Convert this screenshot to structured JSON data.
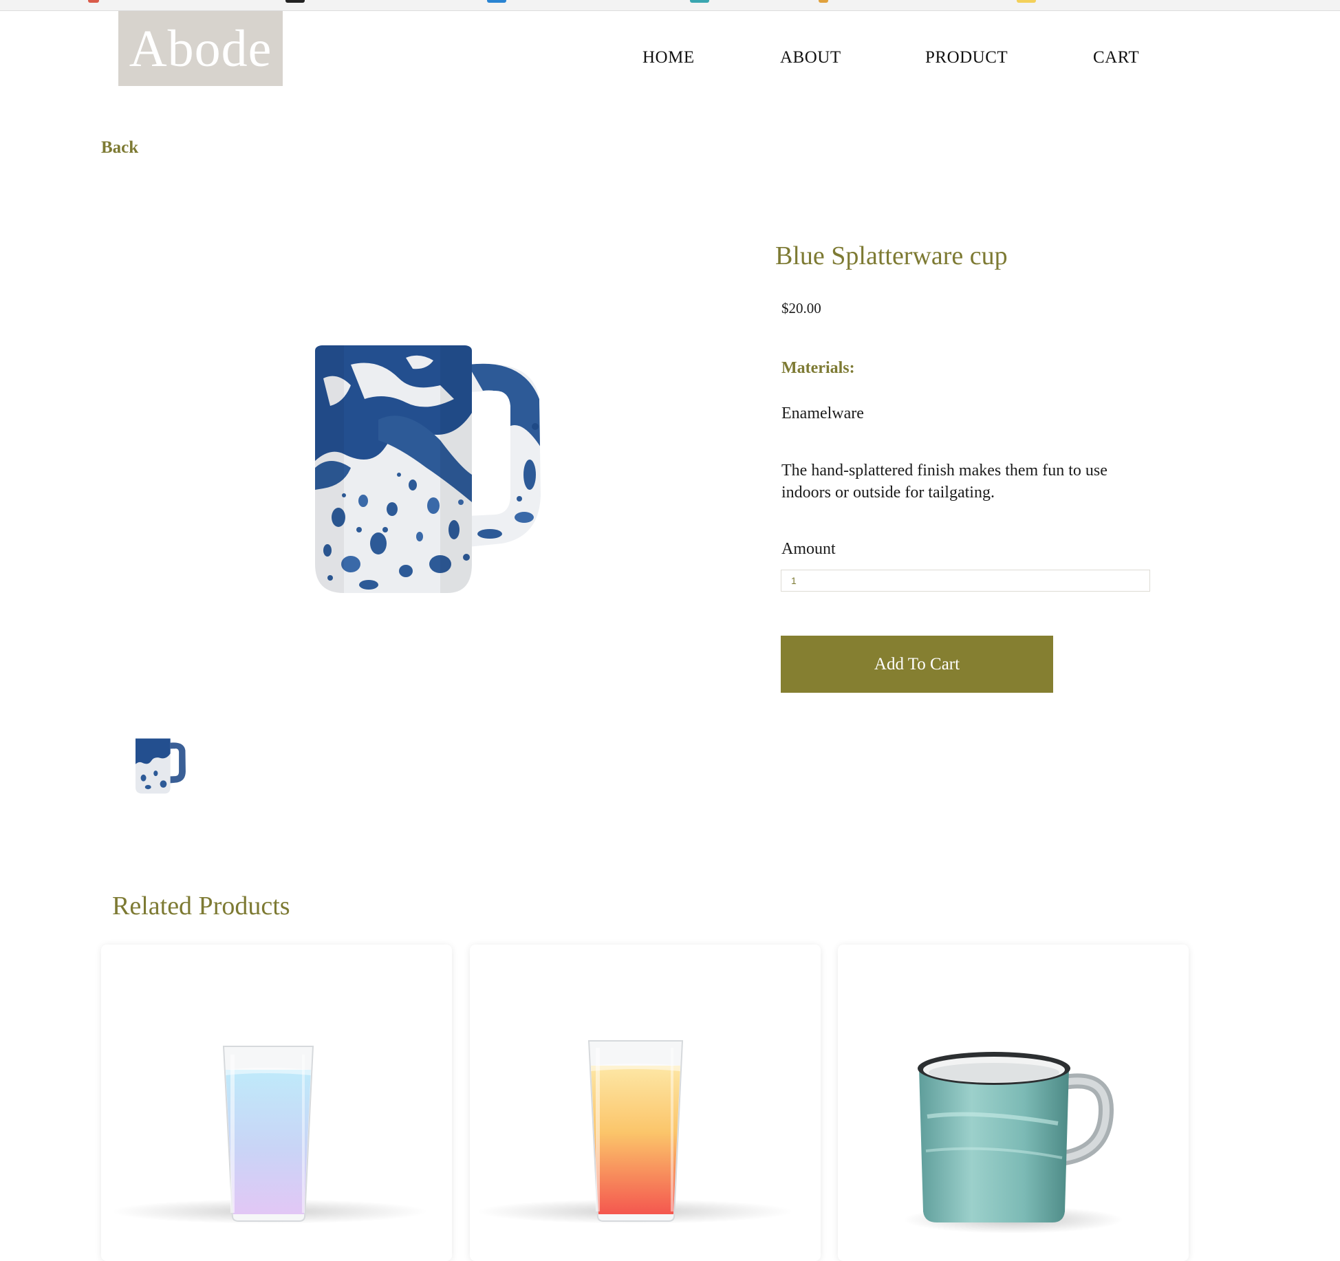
{
  "brand": {
    "logo_text": "Abode",
    "accent_color": "#857f31",
    "logo_bg": "#d7d3cd"
  },
  "nav": {
    "items": [
      {
        "label": "HOME"
      },
      {
        "label": "ABOUT"
      },
      {
        "label": "PRODUCT"
      },
      {
        "label": "CART"
      }
    ]
  },
  "back_link": "Back",
  "product": {
    "name": "Blue Splatterware cup",
    "price": "$20.00",
    "materials_label": "Materials:",
    "materials_value": "Enamelware",
    "description": "The hand-splattered finish makes them fun to use indoors or outside for tailgating.",
    "amount_label": "Amount",
    "amount_value": "1",
    "add_to_cart_label": "Add To Cart",
    "main_image": "blue-splatterware-mug-image",
    "thumbnail": "blue-splatterware-mug-thumbnail"
  },
  "related": {
    "title": "Related Products",
    "items": [
      {
        "image": "blue-purple-gradient-glass-image"
      },
      {
        "image": "yellow-red-gradient-glass-image"
      },
      {
        "image": "teal-enamel-mug-image"
      }
    ]
  }
}
